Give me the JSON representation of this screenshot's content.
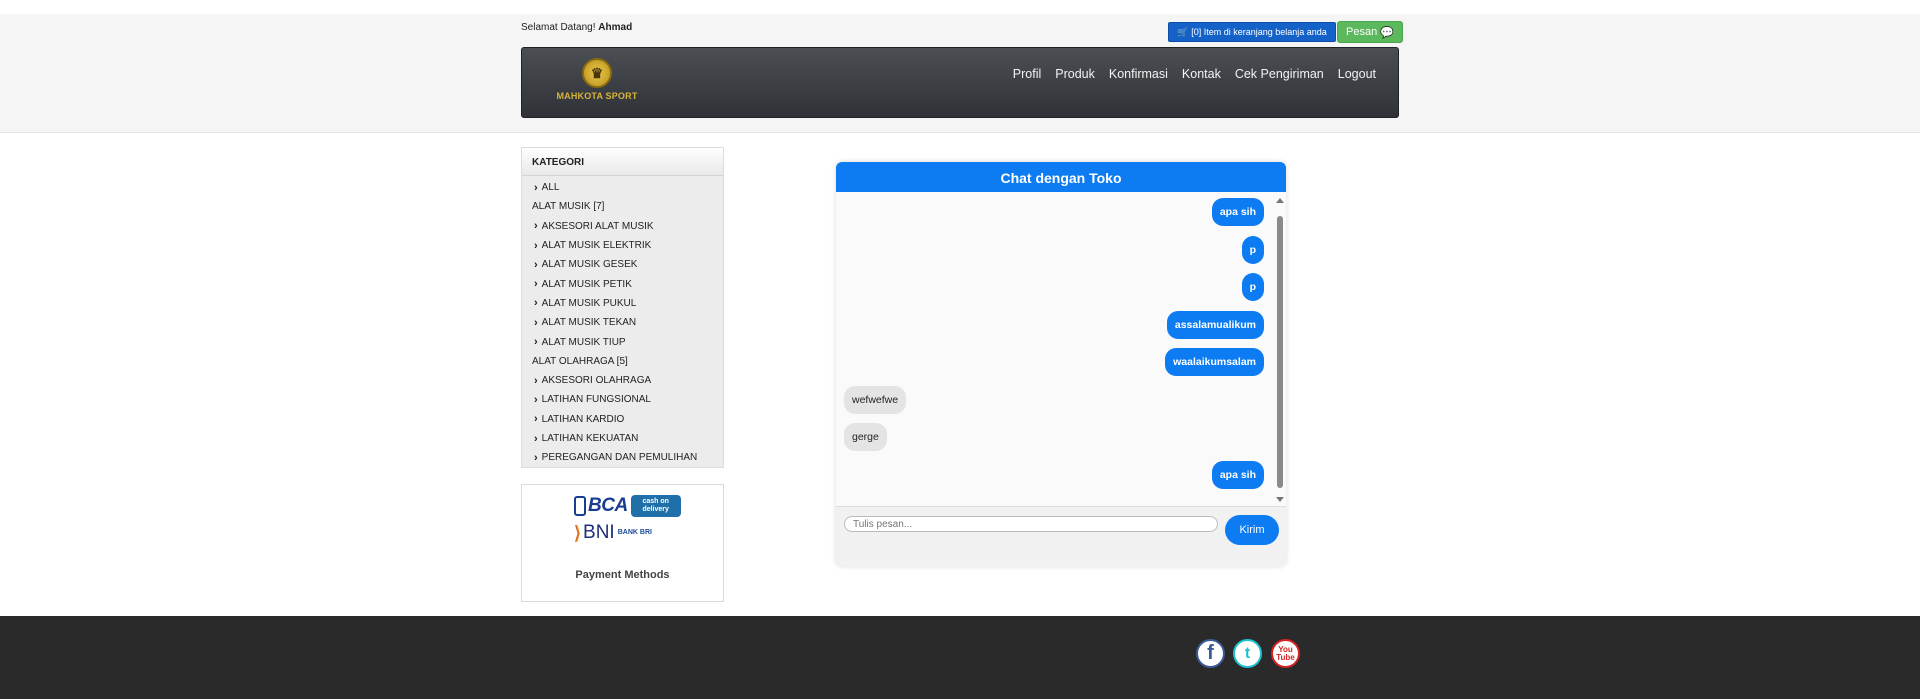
{
  "header": {
    "welcome_prefix": "Selamat Datang!",
    "username": "Ahmad",
    "cart_label": "[0] Item di keranjang belanja anda",
    "message_label": "Pesan"
  },
  "brand": {
    "logo_text": "MAHKOTA SPORT",
    "logo_mark": "♛"
  },
  "nav": [
    "Profil",
    "Produk",
    "Konfirmasi",
    "Kontak",
    "Cek Pengiriman",
    "Logout"
  ],
  "sidebar": {
    "title": "KATEGORI",
    "items": [
      {
        "label": "ALL",
        "type": "sub"
      },
      {
        "label": "ALAT MUSIK [7]",
        "type": "grp"
      },
      {
        "label": "AKSESORI ALAT MUSIK",
        "type": "sub"
      },
      {
        "label": "ALAT MUSIK ELEKTRIK",
        "type": "sub"
      },
      {
        "label": "ALAT MUSIK GESEK",
        "type": "sub"
      },
      {
        "label": "ALAT MUSIK PETIK",
        "type": "sub"
      },
      {
        "label": "ALAT MUSIK PUKUL",
        "type": "sub"
      },
      {
        "label": "ALAT MUSIK TEKAN",
        "type": "sub"
      },
      {
        "label": "ALAT MUSIK TIUP",
        "type": "sub"
      },
      {
        "label": "ALAT OLAHRAGA [5]",
        "type": "grp"
      },
      {
        "label": "AKSESORI OLAHRAGA",
        "type": "sub"
      },
      {
        "label": "LATIHAN FUNGSIONAL",
        "type": "sub"
      },
      {
        "label": "LATIHAN KARDIO",
        "type": "sub"
      },
      {
        "label": "LATIHAN KEKUATAN",
        "type": "sub"
      },
      {
        "label": "PEREGANGAN DAN PEMULIHAN",
        "type": "sub"
      }
    ]
  },
  "payment": {
    "label": "Payment Methods",
    "bca": "BCA",
    "cod": "cash on delivery",
    "bni": "BNI",
    "bri": "BANK BRI"
  },
  "chat": {
    "title": "Chat dengan Toko",
    "messages": [
      {
        "text": "apa sih",
        "from": "out"
      },
      {
        "text": "p",
        "from": "out"
      },
      {
        "text": "p",
        "from": "out"
      },
      {
        "text": "assalamualikum",
        "from": "out"
      },
      {
        "text": "waalaikumsalam",
        "from": "out"
      },
      {
        "text": "wefwefwe",
        "from": "in"
      },
      {
        "text": "gerge",
        "from": "in"
      },
      {
        "text": "apa sih",
        "from": "out"
      }
    ],
    "input_placeholder": "Tulis pesan...",
    "send_label": "Kirim"
  },
  "footer": {
    "social": [
      "facebook-icon",
      "twitter-icon",
      "youtube-icon"
    ]
  },
  "colors": {
    "accent": "#0d7cf2",
    "navbar": "#3a3e43",
    "footer": "#2a2a2a",
    "message_button": "#5cb85c",
    "cart_button": "#1462c8"
  }
}
